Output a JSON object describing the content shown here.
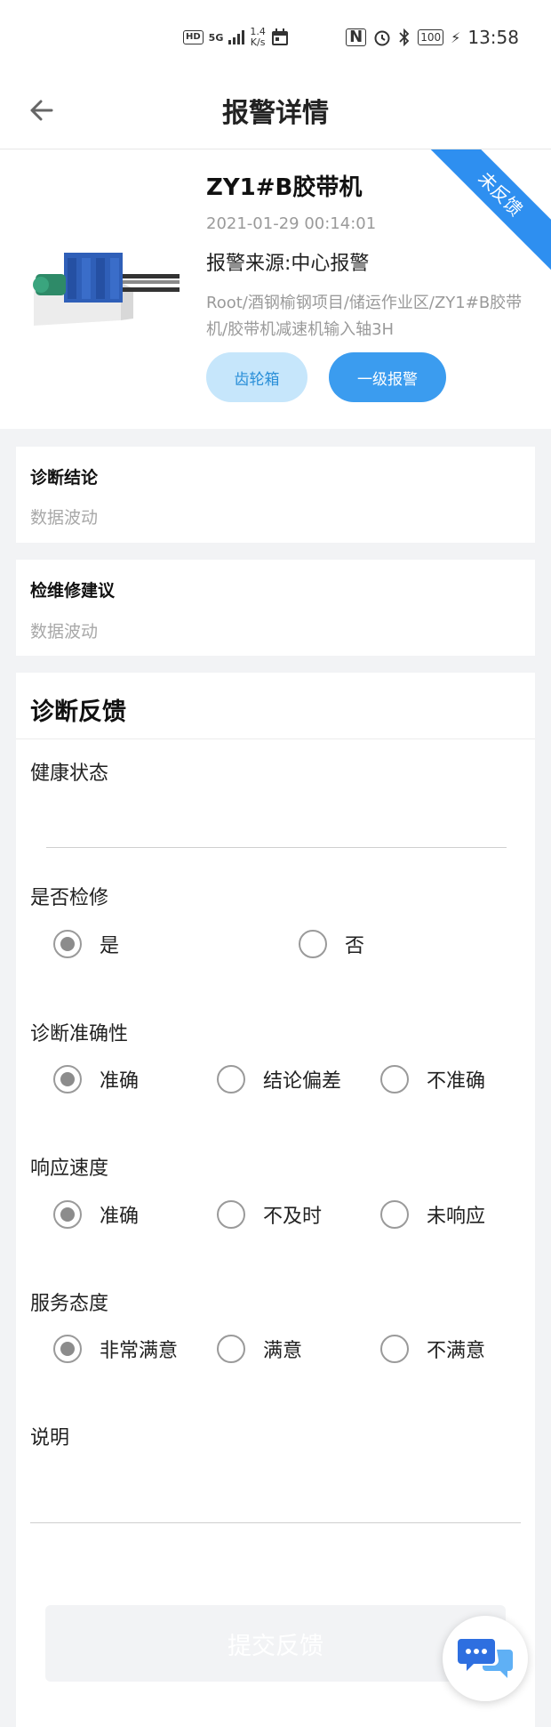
{
  "status_bar": {
    "hd": "HD",
    "signal_label": "5G",
    "speed_value": "1.4",
    "speed_unit": "K/s",
    "battery": "100",
    "time": "13:58"
  },
  "header": {
    "title": "报警详情",
    "back_icon": "arrow-left-icon"
  },
  "alarm": {
    "ribbon": "未反馈",
    "device_name": "ZY1#B胶带机",
    "time": "2021-01-29 00:14:01",
    "source": "报警来源:中心报警",
    "path": "Root/酒钢榆钢项目/储运作业区/ZY1#B胶带机/胶带机减速机输入轴3H",
    "tags": [
      "齿轮箱",
      "一级报警"
    ]
  },
  "diagnosis": {
    "label": "诊断结论",
    "value": "数据波动"
  },
  "maintenance": {
    "label": "检维修建议",
    "value": "数据波动"
  },
  "feedback": {
    "title": "诊断反馈",
    "health": {
      "label": "健康状态",
      "value": ""
    },
    "repair": {
      "label": "是否检修",
      "options": [
        "是",
        "否"
      ],
      "selected": 0
    },
    "accuracy": {
      "label": "诊断准确性",
      "options": [
        "准确",
        "结论偏差",
        "不准确"
      ],
      "selected": 0
    },
    "speed": {
      "label": "响应速度",
      "options": [
        "准确",
        "不及时",
        "未响应"
      ],
      "selected": 0
    },
    "attitude": {
      "label": "服务态度",
      "options": [
        "非常满意",
        "满意",
        "不满意"
      ],
      "selected": 0
    },
    "remark": {
      "label": "说明",
      "value": ""
    },
    "submit_label": "提交反馈"
  },
  "colors": {
    "accent": "#3b9cef",
    "ribbon": "#2e8ff0",
    "tag_light": "#c6e6fb"
  },
  "chat_icon": "chat-bubbles-icon"
}
